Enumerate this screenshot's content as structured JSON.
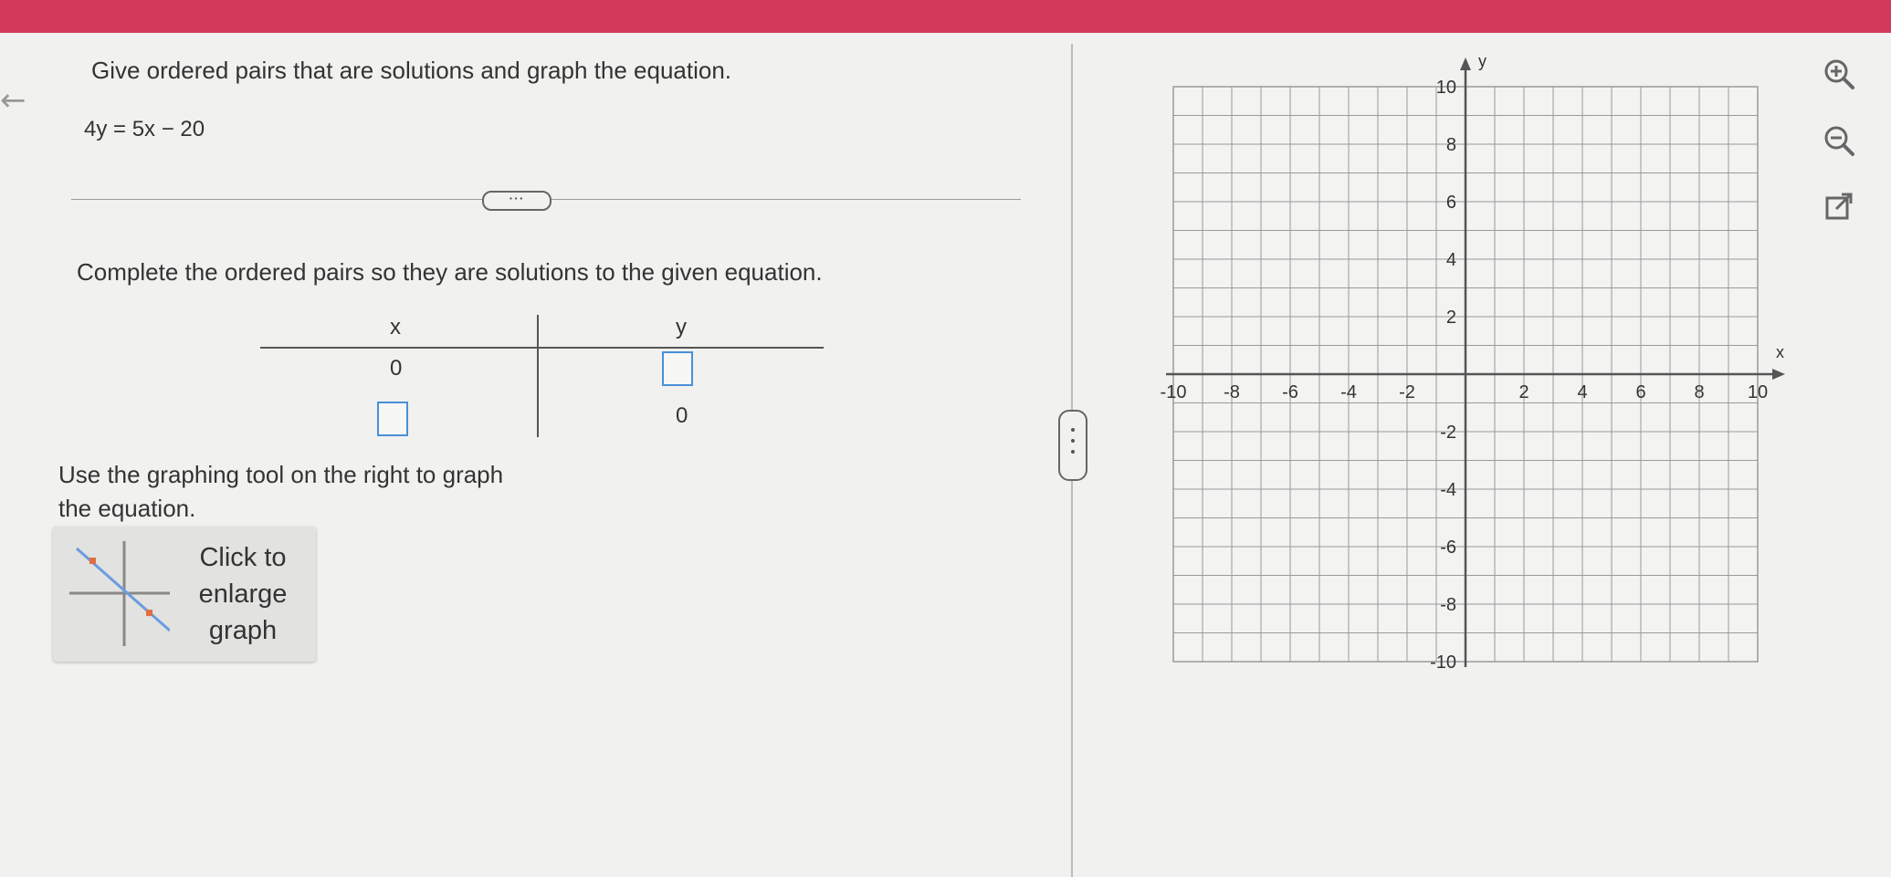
{
  "problem": {
    "instruction": "Give ordered pairs that are solutions and graph the equation.",
    "equation": "4y = 5x − 20",
    "more_label": "···"
  },
  "pairs": {
    "instruction": "Complete the ordered pairs so they are solutions to the given equation.",
    "col_x": "x",
    "col_y": "y",
    "rows": [
      {
        "x": "0",
        "y": ""
      },
      {
        "x": "",
        "y": "0"
      }
    ]
  },
  "graphing": {
    "instruction": "Use the graphing tool on the right to graph the equation.",
    "enlarge_label": "Click to enlarge graph"
  },
  "graph": {
    "x_axis_label": "x",
    "y_axis_label": "y",
    "x_ticks": [
      "-10",
      "-8",
      "-6",
      "-4",
      "-2",
      "2",
      "4",
      "6",
      "8",
      "10"
    ],
    "y_ticks": [
      "10",
      "8",
      "6",
      "4",
      "2",
      "-2",
      "-4",
      "-6",
      "-8",
      "-10"
    ],
    "range": {
      "xmin": -10,
      "xmax": 10,
      "ymin": -10,
      "ymax": 10,
      "step": 1
    }
  },
  "tools": [
    {
      "name": "zoom-in",
      "icon": "zoom-in-icon"
    },
    {
      "name": "zoom-out",
      "icon": "zoom-out-icon"
    },
    {
      "name": "pop-out",
      "icon": "external-link-icon"
    }
  ],
  "colors": {
    "header": "#d23a5c",
    "input_border": "#4a90d9",
    "grid_line": "#9a9a9a",
    "axis": "#555555"
  }
}
